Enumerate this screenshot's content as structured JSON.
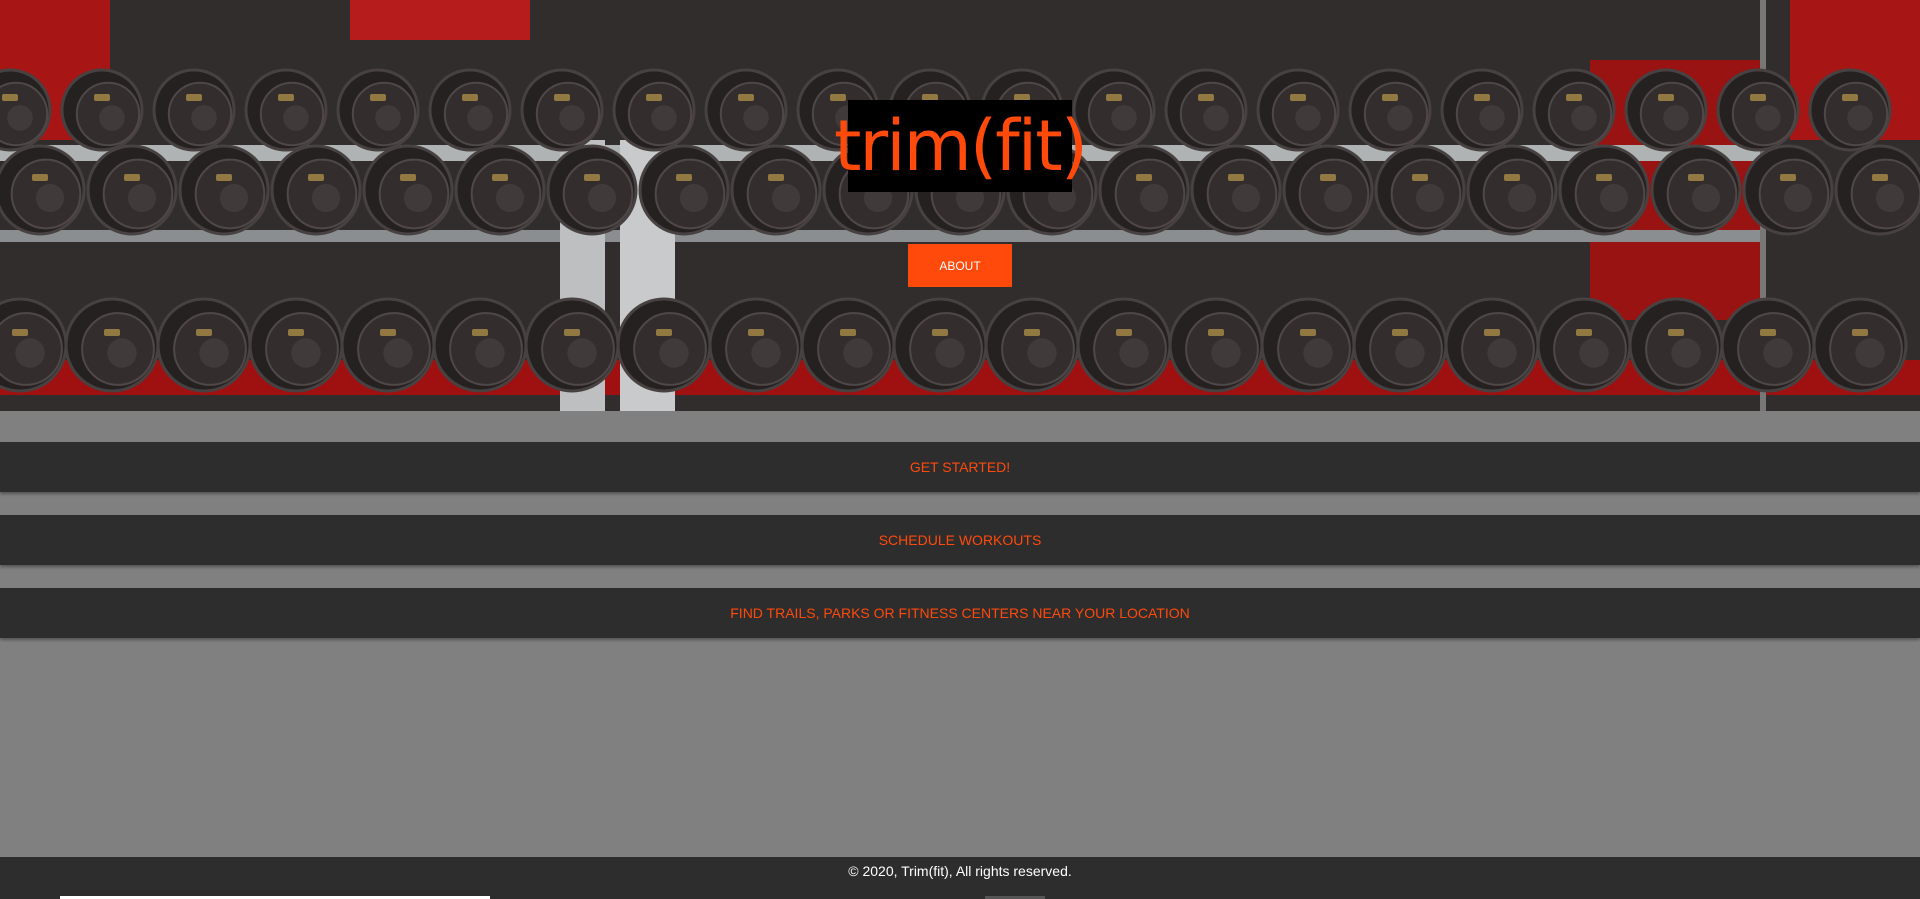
{
  "hero": {
    "logo_text": "trim(fit)",
    "about_label": "ABOUT"
  },
  "actions": {
    "get_started": "GET STARTED!",
    "schedule_workouts": "SCHEDULE WORKOUTS",
    "find_locations": "FIND TRAILS, PARKS OR FITNESS CENTERS NEAR YOUR LOCATION"
  },
  "footer": {
    "copyright": "© 2020, Trim(fit), All rights reserved."
  },
  "colors": {
    "accent": "#ff4a0c",
    "bar_bg": "#2d2d2d",
    "page_bg": "#808080"
  }
}
